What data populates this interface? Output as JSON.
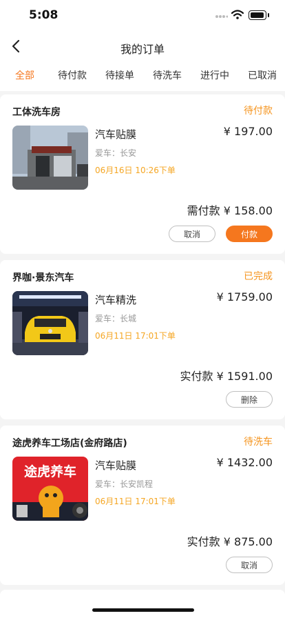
{
  "status_bar": {
    "time": "5:08"
  },
  "nav": {
    "title": "我的订单"
  },
  "tabs": [
    "全部",
    "待付款",
    "待接单",
    "待洗车",
    "进行中",
    "已取消"
  ],
  "active_tab": "全部",
  "orders": [
    {
      "shop": "工体洗车房",
      "status": "待付款",
      "service": "汽车贴膜",
      "price": "¥ 197.00",
      "car": "爱车：长安",
      "time": "06月16日 10:26下单",
      "pay_label": "需付款",
      "pay_amount": "¥ 158.00",
      "buttons": [
        "取消",
        "付款"
      ]
    },
    {
      "shop": "界咖·景东汽车",
      "status": "已完成",
      "service": "汽车精洗",
      "price": "¥ 1759.00",
      "car": "爱车：长城",
      "time": "06月11日 17:01下单",
      "pay_label": "实付款",
      "pay_amount": "¥ 1591.00",
      "buttons": [
        "删除"
      ]
    },
    {
      "shop": "途虎养车工场店(金府路店)",
      "status": "待洗车",
      "service": "汽车贴膜",
      "price": "¥ 1432.00",
      "car": "爱车：长安凯程",
      "time": "06月11日 17:01下单",
      "pay_label": "实付款",
      "pay_amount": "¥ 875.00",
      "buttons": [
        "取消"
      ],
      "image_text": "途虎养车"
    }
  ],
  "colors": {
    "accent": "#f5771e",
    "status": "#f5941e",
    "time": "#f5a623"
  }
}
